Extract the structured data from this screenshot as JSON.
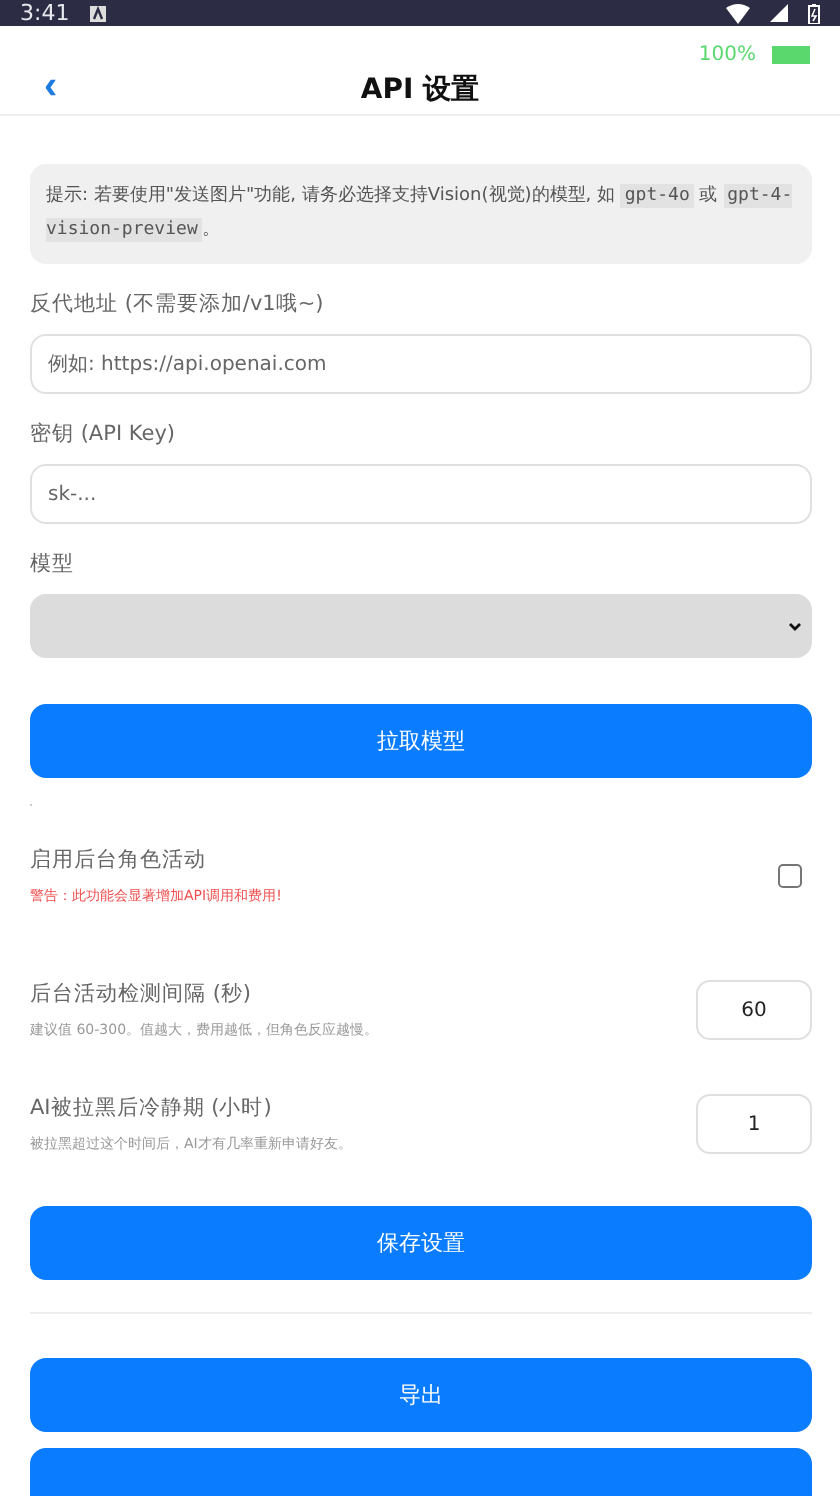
{
  "status_bar": {
    "time": "3:41"
  },
  "battery": {
    "percent": "100%",
    "level": 1
  },
  "header": {
    "back": "‹",
    "title": "API 设置"
  },
  "tip": {
    "parts": [
      {
        "kind": "text",
        "text": "提示: 若要使用\"发送图片\"功能, 请务必选择支持Vision(视觉)的模型, 如 "
      },
      {
        "kind": "code",
        "text": "gpt-4o"
      },
      {
        "kind": "text",
        "text": " 或 "
      },
      {
        "kind": "code",
        "text": "gpt-4-vision-preview"
      },
      {
        "kind": "text",
        "text": "。"
      }
    ]
  },
  "proxy": {
    "label": "反代地址 (不需要添加/v1哦~)",
    "placeholder": "例如: https://api.openai.com"
  },
  "api_key": {
    "label": "密钥 (API Key)",
    "placeholder": "sk-..."
  },
  "model": {
    "label": "模型",
    "button": "拉取模型"
  },
  "background_activity": {
    "label": "启用后台角色活动",
    "warning": "警告：此功能会显著增加API调用和费用!",
    "checked": false
  },
  "number_settings": [
    {
      "label": "后台活动检测间隔 (秒)",
      "hint": "建议值 60-300。值越大，费用越低，但角色反应越慢。",
      "value": "60"
    },
    {
      "label": "AI被拉黑后冷静期 (小时)",
      "hint": "被拉黑超过这个时间后，AI才有几率重新申请好友。",
      "value": "1"
    }
  ],
  "save_button": "保存设置",
  "bottom_buttons": [
    {
      "kind": "labeled",
      "label": "导出"
    },
    {
      "kind": "blank"
    }
  ]
}
